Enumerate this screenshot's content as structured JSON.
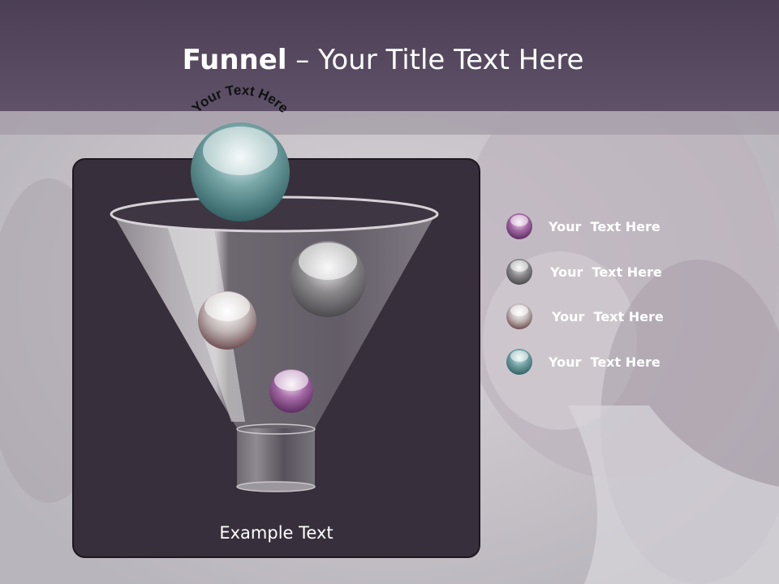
{
  "slide": {
    "title_bold": "Funnel",
    "title_rest": " – Your Title Text Here",
    "arc_text": "Your Text Here",
    "example_text": "Example Text"
  },
  "legend": [
    {
      "label": "Your  Text Here",
      "color": "#8a4d8f"
    },
    {
      "label": "Your  Text Here",
      "color": "#4a4a4a"
    },
    {
      "label": "Your  Text Here",
      "color": "#8f7f7e"
    },
    {
      "label": "Your  Text Here",
      "color": "#3f7c7e"
    }
  ]
}
